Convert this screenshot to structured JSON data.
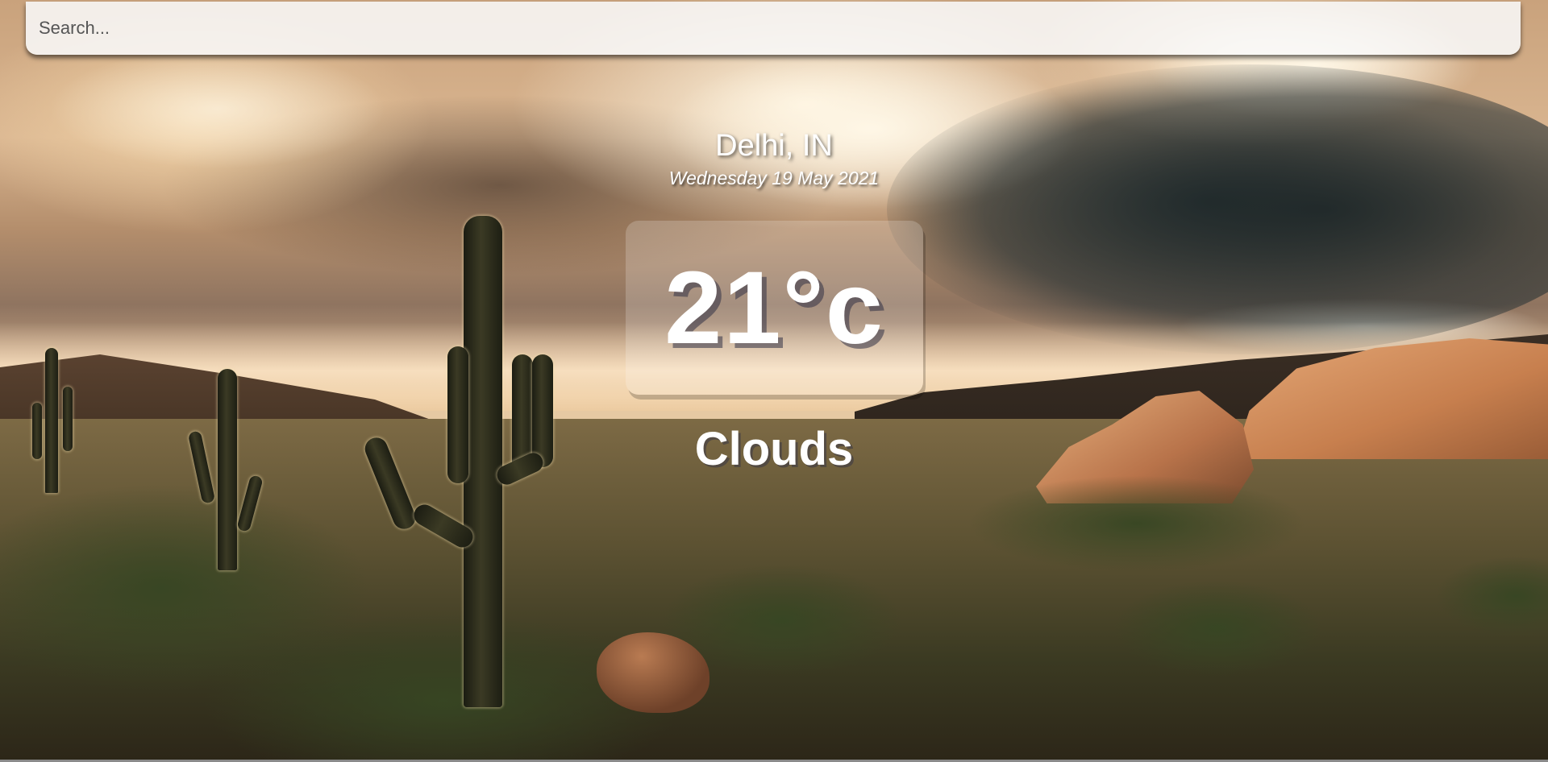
{
  "search": {
    "placeholder": "Search...",
    "value": ""
  },
  "location": {
    "city": "Delhi, IN",
    "date": "Wednesday 19 May 2021"
  },
  "current": {
    "temperature": "21°c",
    "condition": "Clouds"
  },
  "background": {
    "description_icon": "desert-landscape-image"
  }
}
